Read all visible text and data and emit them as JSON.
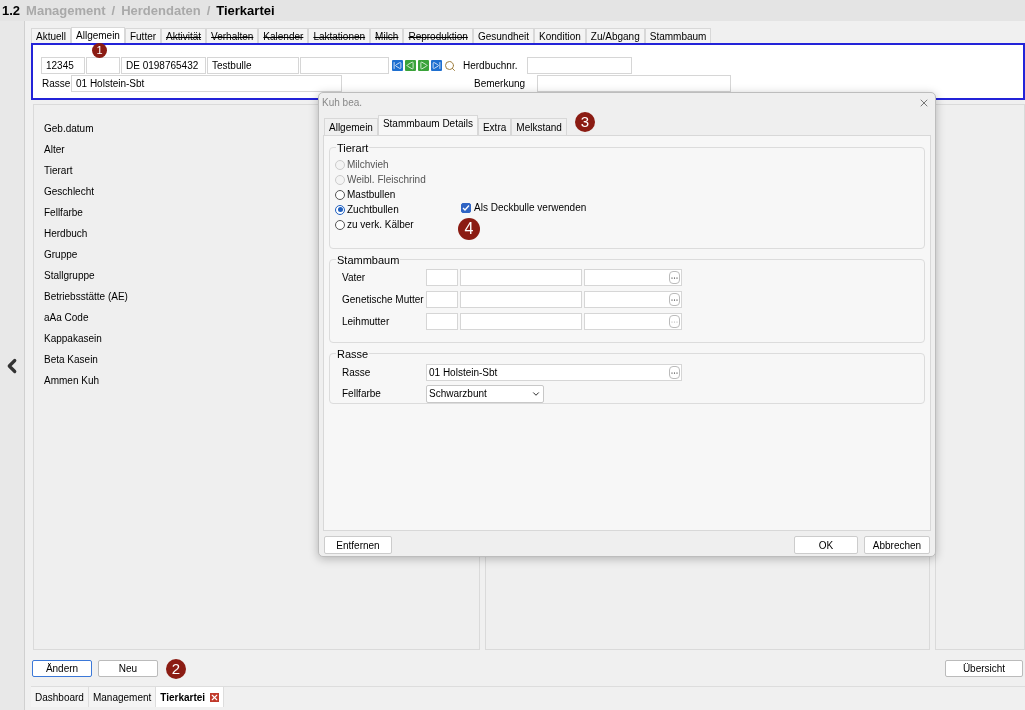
{
  "breadcrumb": {
    "number": "1.2",
    "separator": "/",
    "items": [
      {
        "label": "Management",
        "current": false
      },
      {
        "label": "Herdendaten",
        "current": false
      },
      {
        "label": "Tierkartei",
        "current": true
      }
    ]
  },
  "tabs": [
    {
      "label": "Aktuell",
      "selected": false,
      "struck": false
    },
    {
      "label": "Allgemein",
      "selected": true,
      "struck": false
    },
    {
      "label": "Futter",
      "selected": false,
      "struck": false
    },
    {
      "label": "Aktivität",
      "selected": false,
      "struck": true
    },
    {
      "label": "Verhalten",
      "selected": false,
      "struck": true
    },
    {
      "label": "Kalender",
      "selected": false,
      "struck": true
    },
    {
      "label": "Laktationen",
      "selected": false,
      "struck": true
    },
    {
      "label": "Milch",
      "selected": false,
      "struck": true
    },
    {
      "label": "Reproduktion",
      "selected": false,
      "struck": true
    },
    {
      "label": "Gesundheit",
      "selected": false,
      "struck": false
    },
    {
      "label": "Kondition",
      "selected": false,
      "struck": false
    },
    {
      "label": "Zu/Abgang",
      "selected": false,
      "struck": false
    },
    {
      "label": "Stammbaum",
      "selected": false,
      "struck": false
    }
  ],
  "record": {
    "number": "12345",
    "ear_tag": "DE 0198765432",
    "name": "Testbulle",
    "herdbook_label": "Herdbuchnr.",
    "breed_label": "Rasse",
    "breed": "01 Holstein-Sbt",
    "remark_label": "Bemerkung"
  },
  "detail_labels": [
    "Geb.datum",
    "Alter",
    "Tierart",
    "Geschlecht",
    "Fellfarbe",
    "Herdbuch",
    "Gruppe",
    "Stallgruppe",
    "Betriebsstätte (AE)",
    "aAa Code",
    "Kappakasein",
    "Beta Kasein",
    "Ammen Kuh"
  ],
  "buttons": [
    {
      "label": "Ändern",
      "focused": true
    },
    {
      "label": "Neu",
      "focused": false
    }
  ],
  "overview_button": "Übersicht",
  "bottom_tabs": [
    {
      "label": "Dashboard",
      "selected": false,
      "closable": false
    },
    {
      "label": "Management",
      "selected": false,
      "closable": false
    },
    {
      "label": "Tierkartei",
      "selected": true,
      "closable": true
    }
  ],
  "dialog": {
    "title": "Kuh bea.",
    "tabs": [
      {
        "label": "Allgemein",
        "selected": false
      },
      {
        "label": "Stammbaum Details",
        "selected": true
      },
      {
        "label": "Extra",
        "selected": false
      },
      {
        "label": "Melkstand",
        "selected": false
      }
    ],
    "tierart": {
      "title": "Tierart",
      "options": [
        {
          "label": "Milchvieh",
          "selected": false,
          "disabled": true
        },
        {
          "label": "Weibl. Fleischrind",
          "selected": false,
          "disabled": true
        },
        {
          "label": "Mastbullen",
          "selected": false,
          "disabled": false
        },
        {
          "label": "Zuchtbullen",
          "selected": true,
          "disabled": false
        },
        {
          "label": "zu verk. Kälber",
          "selected": false,
          "disabled": false
        }
      ],
      "checkbox": {
        "label": "Als Deckbulle verwenden",
        "checked": true
      }
    },
    "stammbaum": {
      "title": "Stammbaum",
      "rows": [
        {
          "label": "Vater",
          "enabled": true
        },
        {
          "label": "Genetische Mutter",
          "enabled": true
        },
        {
          "label": "Leihmutter",
          "enabled": false
        }
      ]
    },
    "rasse": {
      "title": "Rasse",
      "breed_label": "Rasse",
      "breed": "01 Holstein-Sbt",
      "color_label": "Fellfarbe",
      "coat_color": "Schwarzbunt"
    },
    "footer": {
      "remove": "Entfernen",
      "ok": "OK",
      "cancel": "Abbrechen"
    }
  },
  "badges": [
    "1",
    "2",
    "3",
    "4"
  ]
}
